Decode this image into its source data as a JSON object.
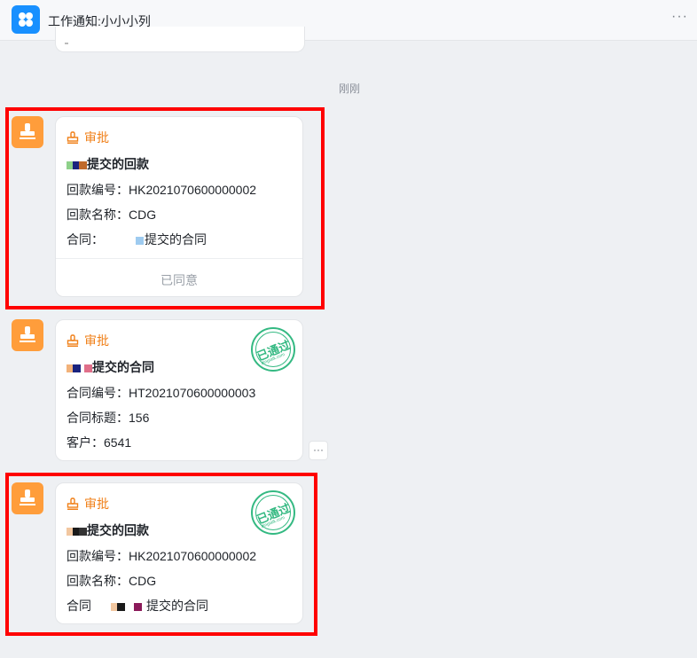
{
  "header": {
    "title": "工作通知:小小小列",
    "more": "···"
  },
  "timestamp": "刚刚",
  "colors": {
    "accent": "#f07f17",
    "approved_green": "#34b982",
    "app_blue": "#1890ff",
    "highlight": "#ff0000"
  },
  "messages": [
    {
      "tag": "审批",
      "title_suffix": "提交的回款",
      "rows": [
        {
          "label": "回款编号：",
          "value": "HK2021070600000002"
        },
        {
          "label": "回款名称：",
          "value": "CDG"
        },
        {
          "label": "合同：",
          "value": "提交的合同"
        }
      ],
      "footer": "已同意"
    },
    {
      "tag": "审批",
      "title_suffix": "提交的合同",
      "stamp": "已通过",
      "stamp_sub": "dingtalk.com",
      "rows": [
        {
          "label": "合同编号：",
          "value": "HT2021070600000003"
        },
        {
          "label": "合同标题：",
          "value": "156"
        },
        {
          "label": "客户：",
          "value": "6541"
        }
      ],
      "more": "···"
    },
    {
      "tag": "审批",
      "title_suffix": "提交的回款",
      "stamp": "已通过",
      "stamp_sub": "dingtalk.com",
      "rows": [
        {
          "label": "回款编号：",
          "value": "HK2021070600000002"
        },
        {
          "label": "回款名称：",
          "value": "CDG"
        },
        {
          "label": "合同",
          "value": "提交的合同"
        }
      ]
    }
  ]
}
